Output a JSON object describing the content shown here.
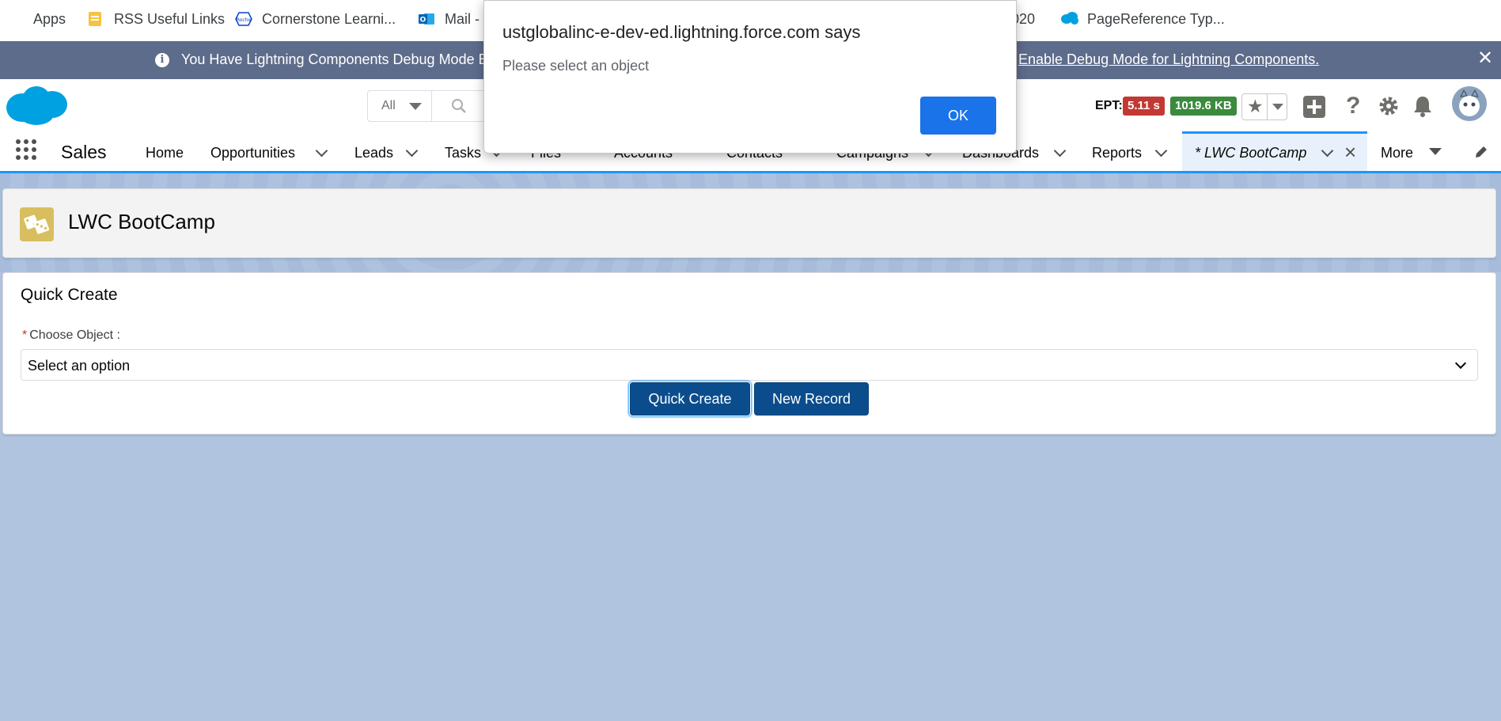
{
  "bookmarks": {
    "items": [
      {
        "label": "Apps",
        "icon": "apps-grid-icon"
      },
      {
        "label": "RSS Useful Links",
        "icon": "folder-icon"
      },
      {
        "label": "Cornerstone Learni...",
        "icon": "roche-icon"
      },
      {
        "label": "Mail -",
        "icon": "outlook-icon"
      },
      {
        "label": "020",
        "icon": ""
      },
      {
        "label": "PageReference Typ...",
        "icon": "salesforce-cloud-icon"
      }
    ]
  },
  "banner": {
    "message": "You Have Lightning Components Debug Mode E",
    "link": "Enable Debug Mode for Lightning Components."
  },
  "header": {
    "search_scope": "All",
    "ept_label": "EPT:",
    "ept_value": "5.11 s",
    "size_value": "1019.6 KB",
    "colors": {
      "ept_badge": "#c23934",
      "size_badge": "#3b8a3d",
      "brand": "#00a1e0"
    }
  },
  "nav": {
    "app_name": "Sales",
    "items": [
      "Home",
      "Opportunities",
      "Leads",
      "Tasks",
      "Files",
      "Accounts",
      "Contacts",
      "Campaigns",
      "Dashboards",
      "Reports"
    ],
    "active_tab": "* LWC BootCamp",
    "more_label": "More"
  },
  "page": {
    "title": "LWC BootCamp"
  },
  "quick_create": {
    "title": "Quick Create",
    "field_label": "Choose Object :",
    "required_mark": "*",
    "select_value": "Select an option",
    "quick_create_button": "Quick Create",
    "new_record_button": "New Record"
  },
  "dialog": {
    "title": "ustglobalinc-e-dev-ed.lightning.force.com says",
    "message": "Please select an object",
    "ok_label": "OK"
  }
}
